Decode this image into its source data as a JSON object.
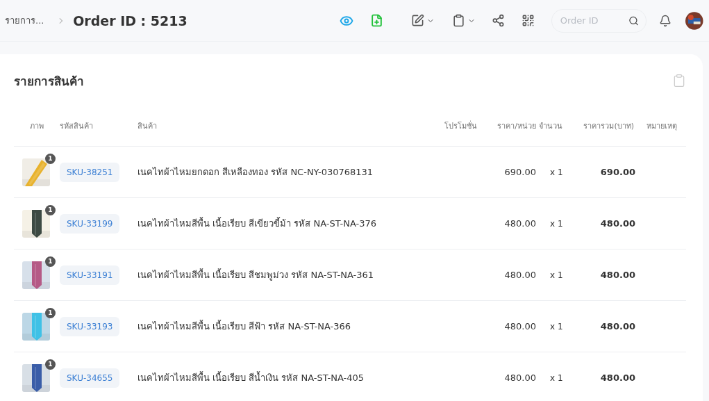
{
  "header": {
    "breadcrumb": "รายการ...",
    "title": "Order ID : 5213",
    "search": {
      "placeholder": "Order ID"
    }
  },
  "card": {
    "title": "รายการสินค้า",
    "columns": [
      "ภาพ",
      "รหัสสินค้า",
      "สินค้า",
      "โปรโมชั่น",
      "ราคา/หน่วย",
      "จำนวน",
      "ราคารวม(บาท)",
      "หมายเหตุ"
    ],
    "rows": [
      {
        "badge": "1",
        "sku": "SKU-38251",
        "product": "เนคไทผ้าไหมยกดอก สีเหลืองทอง รหัส NC-NY-030768131",
        "unit_price": "690.00",
        "quantity": "x 1",
        "total": "690.00"
      },
      {
        "badge": "1",
        "sku": "SKU-33199",
        "product": "เนคไทผ้าไหมสีพื้น เนื้อเรียบ สีเขียวขี้ม้า รหัส NA-ST-NA-376",
        "unit_price": "480.00",
        "quantity": "x 1",
        "total": "480.00"
      },
      {
        "badge": "1",
        "sku": "SKU-33191",
        "product": "เนคไทผ้าไหมสีพื้น เนื้อเรียบ สีชมพูม่วง รหัส NA-ST-NA-361",
        "unit_price": "480.00",
        "quantity": "x 1",
        "total": "480.00"
      },
      {
        "badge": "1",
        "sku": "SKU-33193",
        "product": "เนคไทผ้าไหมสีพื้น เนื้อเรียบ สีฟ้า รหัส NA-ST-NA-366",
        "unit_price": "480.00",
        "quantity": "x 1",
        "total": "480.00"
      },
      {
        "badge": "1",
        "sku": "SKU-34655",
        "product": "เนคไทผ้าไหมสีพื้น เนื้อเรียบ สีน้ำเงิน รหัส NA-ST-NA-405",
        "unit_price": "480.00",
        "quantity": "x 1",
        "total": "480.00"
      }
    ]
  }
}
